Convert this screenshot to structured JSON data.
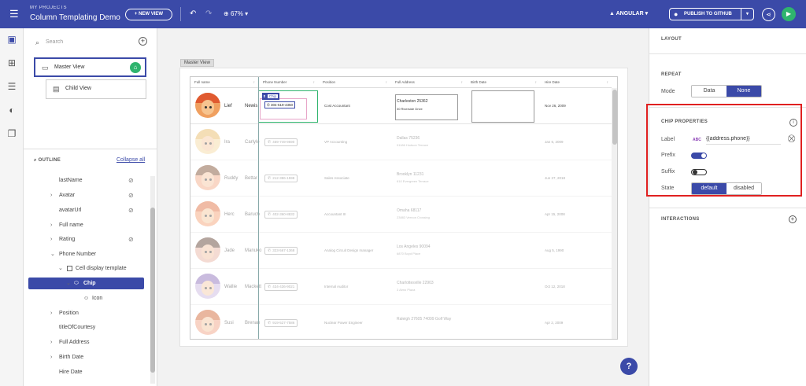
{
  "topbar": {
    "project_label": "MY PROJECTS",
    "project_title": "Column Templating Demo",
    "new_view": "+ NEW VIEW",
    "zoom": "67%",
    "framework": "ANGULAR",
    "publish": "PUBLISH TO GITHUB"
  },
  "left": {
    "search_placeholder": "Search",
    "views": [
      {
        "label": "Master View"
      },
      {
        "label": "Child View"
      }
    ],
    "outline_title": "OUTLINE",
    "collapse_all": "Collapse all",
    "tree": [
      {
        "label": "lastName",
        "hidden": true
      },
      {
        "label": "Avatar",
        "hidden": true,
        "expandable": true
      },
      {
        "label": "avatarUrl",
        "hidden": true
      },
      {
        "label": "Full name",
        "expandable": true
      },
      {
        "label": "Rating",
        "hidden": true,
        "expandable": true
      },
      {
        "label": "Phone Number"
      },
      {
        "label": "Cell display template"
      },
      {
        "label": "Chip",
        "selected": true
      },
      {
        "label": "Icon"
      },
      {
        "label": "Position",
        "expandable": true
      },
      {
        "label": "titleOfCourtesy"
      },
      {
        "label": "Full Address",
        "expandable": true
      },
      {
        "label": "Birth Date",
        "expandable": true
      },
      {
        "label": "Hire Date"
      }
    ]
  },
  "canvas": {
    "view_label": "Master View",
    "columns": [
      "Full name",
      "Phone Number",
      "Position",
      "Full Address",
      "Birth Date",
      "Hire Date"
    ],
    "chip_tag": "Chip",
    "rows": [
      {
        "first": "Lief",
        "last": "Newis",
        "phone": "304-519-4350",
        "position": "Cost Accountant",
        "addr1": "Charleston 25362",
        "addr2": "00 Riverside Drive",
        "hire": "Nov 26, 2009"
      },
      {
        "first": "Ira",
        "last": "Carlyle",
        "phone": "469-749-9690",
        "position": "VP Accounting",
        "addr1": "Dallas 75236",
        "addr2": "01186 Hudson Terrace",
        "hire": "Jan 6, 2009"
      },
      {
        "first": "Ruddy",
        "last": "Bettar",
        "phone": "212-386-1598",
        "position": "Sales Associate",
        "addr1": "Brooklyn 11231",
        "addr2": "610 Evergreen Terrace",
        "hire": "Jun 27, 2018"
      },
      {
        "first": "Herc",
        "last": "Baruch",
        "phone": "402-360-8832",
        "position": "Accountant III",
        "addr1": "Omaha 68117",
        "addr2": "23883 Vernon Crossing",
        "hire": "Apr 15, 2008"
      },
      {
        "first": "Jade",
        "last": "Manuko",
        "phone": "323-567-1368",
        "position": "Analog Circuit Design manager",
        "addr1": "Los Angeles 90094",
        "addr2": "6870 Boyd Place",
        "hire": "Aug 5, 1990"
      },
      {
        "first": "Wallie",
        "last": "Mackett",
        "phone": "434-436-9021",
        "position": "Internal Auditor",
        "addr1": "Charlottesville 22903",
        "addr2": "3 Almo Plaza",
        "hire": "Oct 12, 2018"
      },
      {
        "first": "Susi",
        "last": "Brenan",
        "phone": "919-527-7586",
        "position": "Nuclear Power Engineer",
        "addr1": "Raleigh 27605 74099 Golf Way",
        "addr2": "",
        "hire": "Apr 2, 2009"
      }
    ]
  },
  "right": {
    "layout_title": "LAYOUT",
    "repeat_title": "REPEAT",
    "mode_label": "Mode",
    "mode_options": [
      "Data",
      "None"
    ],
    "mode_selected": "None",
    "chip_props_title": "CHIP PROPERTIES",
    "label_label": "Label",
    "label_type": "ABC",
    "label_value": "{{address.phone}}",
    "prefix_label": "Prefix",
    "prefix_on": true,
    "suffix_label": "Suffix",
    "suffix_on": false,
    "state_label": "State",
    "state_options": [
      "default",
      "disabled"
    ],
    "state_selected": "default",
    "interactions_title": "INTERACTIONS"
  },
  "colors": {
    "primary": "#3b4aa8",
    "success": "#2fb46e",
    "highlight": "#e02020"
  },
  "icons": [
    "menu-icon",
    "undo-icon",
    "redo-icon",
    "zoom-icon",
    "angular-icon",
    "github-icon",
    "share-icon",
    "play-icon",
    "help-icon",
    "info-icon",
    "unbind-icon",
    "add-icon",
    "phone-icon",
    "eye-off-icon"
  ]
}
